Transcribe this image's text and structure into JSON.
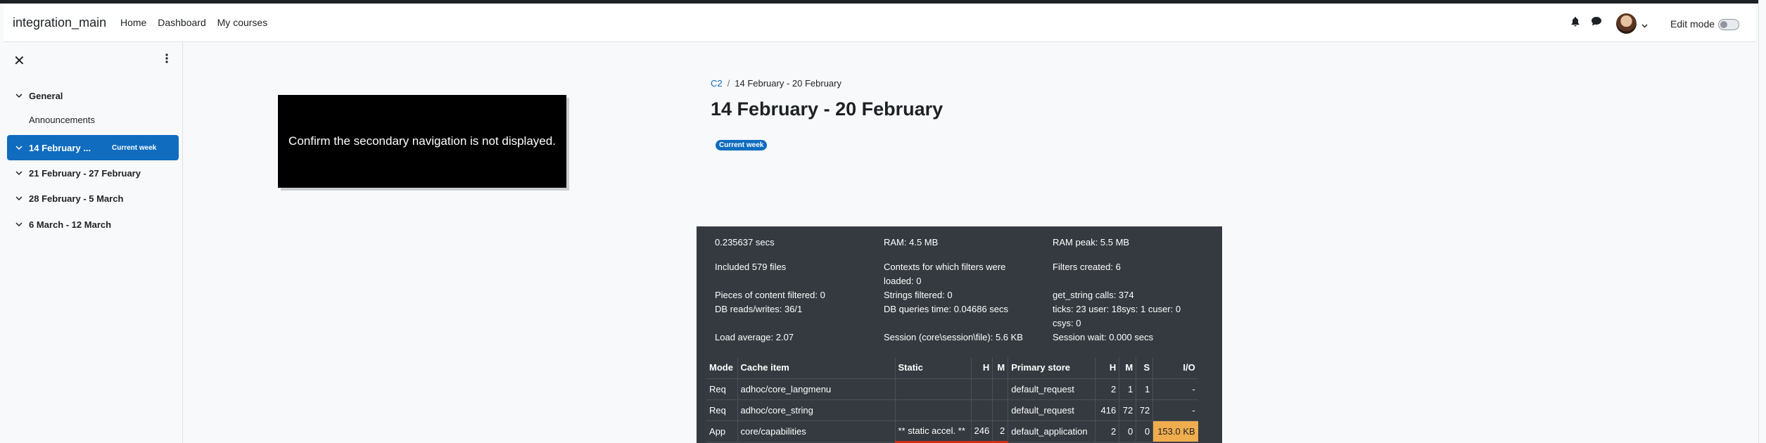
{
  "navbar": {
    "site_name": "integration_main",
    "links": [
      "Home",
      "Dashboard",
      "My courses"
    ],
    "edit_mode_label": "Edit mode",
    "edit_mode_on": false
  },
  "drawer": {
    "sections": [
      {
        "label": "General",
        "expanded": true
      },
      {
        "label": "14 February ...",
        "badge": "Current week",
        "active": true
      },
      {
        "label": "21 February - 27 February"
      },
      {
        "label": "28 February - 5 March"
      },
      {
        "label": "6 March - 12 March"
      }
    ],
    "general_items": [
      "Announcements"
    ]
  },
  "tour": {
    "text": "Confirm the secondary navigation is not displayed."
  },
  "breadcrumb": {
    "course": "C2",
    "current": "14 February - 20 February"
  },
  "page": {
    "title": "14 February - 20 February",
    "badge": "Current week"
  },
  "perf": {
    "items": [
      "0.235637 secs",
      "RAM: 4.5 MB",
      "RAM peak: 5.5 MB",
      "Included 579 files",
      "Contexts for which filters were loaded: 0",
      "Filters created: 6",
      "Pieces of content filtered: 0",
      "Strings filtered: 0",
      "get_string calls: 374",
      "DB reads/writes: 36/1",
      "DB queries time: 0.04686 secs",
      "ticks: 23 user: 18sys: 1 cuser: 0 csys: 0",
      "Load average: 2.07",
      "Session (core\\session\\file): 5.6 KB",
      "Session wait: 0.000 secs"
    ],
    "table": {
      "headers": [
        "Mode",
        "Cache item",
        "Static",
        "H",
        "M",
        "Primary store",
        "H",
        "M",
        "S",
        "I/O"
      ],
      "rows": [
        [
          "Req",
          "adhoc/core_langmenu",
          "",
          "",
          "",
          "default_request",
          "2",
          "1",
          "1",
          "-"
        ],
        [
          "Req",
          "adhoc/core_string",
          "",
          "",
          "",
          "default_request",
          "416",
          "72",
          "72",
          "-"
        ],
        [
          "App",
          "core/capabilities",
          "** static accel. **",
          "246",
          "2",
          "default_application",
          "2",
          "0",
          "0",
          "153.0 KB"
        ]
      ]
    }
  }
}
